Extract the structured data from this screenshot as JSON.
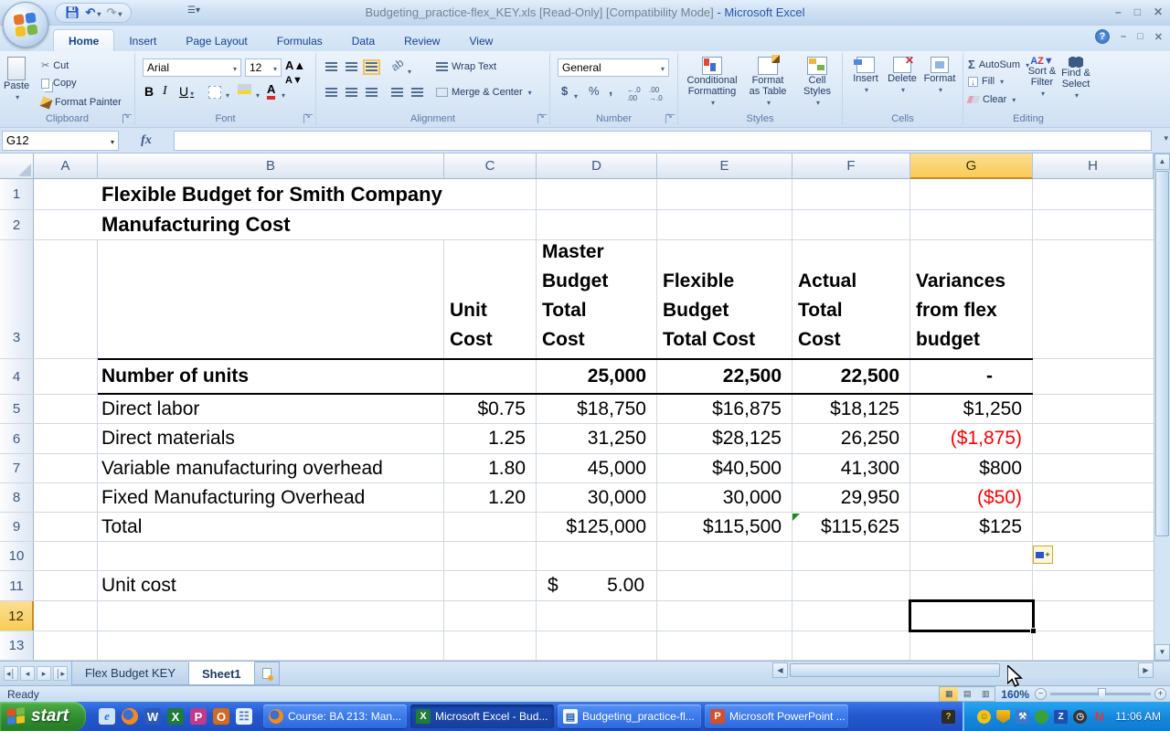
{
  "titlebar": {
    "filename": "Budgeting_practice-flex_KEY.xls  [Read-Only]  [Compatibility Mode]",
    "app": "- Microsoft Excel"
  },
  "ribbon": {
    "tabs": [
      {
        "label": "Home"
      },
      {
        "label": "Insert"
      },
      {
        "label": "Page Layout"
      },
      {
        "label": "Formulas"
      },
      {
        "label": "Data"
      },
      {
        "label": "Review"
      },
      {
        "label": "View"
      }
    ],
    "clipboard": {
      "label": "Clipboard",
      "paste": "Paste",
      "cut": "Cut",
      "copy": "Copy",
      "format_painter": "Format Painter"
    },
    "font": {
      "label": "Font",
      "family": "Arial",
      "size": "12"
    },
    "alignment": {
      "label": "Alignment",
      "wrap": "Wrap Text",
      "merge": "Merge & Center"
    },
    "number": {
      "label": "Number",
      "format": "General"
    },
    "styles": {
      "label": "Styles",
      "conditional": "Conditional\nFormatting",
      "as_table": "Format\nas Table",
      "cell_styles": "Cell\nStyles"
    },
    "cells": {
      "label": "Cells",
      "insert": "Insert",
      "delete": "Delete",
      "format": "Format"
    },
    "editing": {
      "label": "Editing",
      "autosum": "AutoSum",
      "fill": "Fill",
      "clear": "Clear",
      "sort": "Sort &\nFilter",
      "find": "Find &\nSelect"
    }
  },
  "formula_bar": {
    "name_box": "G12",
    "fx": "fx",
    "content": ""
  },
  "sheet": {
    "col_headers": [
      "A",
      "B",
      "C",
      "D",
      "E",
      "F",
      "G",
      "H"
    ],
    "row_headers": [
      "1",
      "2",
      "3",
      "4",
      "5",
      "6",
      "7",
      "8",
      "9",
      "10",
      "11",
      "12",
      "13"
    ],
    "selected_cell": "G12",
    "r1_title": "Flexible Budget for Smith Company",
    "r2_title": "Manufacturing Cost",
    "h": {
      "c": "Unit\nCost",
      "d": "Master\nBudget\nTotal\nCost",
      "e": "Flexible\nBudget\nTotal Cost",
      "f": "Actual\nTotal\nCost",
      "g": "Variances\nfrom flex\nbudget"
    },
    "r4": {
      "b": "Number of units",
      "d": "25,000",
      "e": "22,500",
      "f": "22,500",
      "g": "-"
    },
    "r5": {
      "b": "Direct labor",
      "c": "$0.75",
      "d": "$18,750",
      "e": "$16,875",
      "f": "$18,125",
      "g": "$1,250"
    },
    "r6": {
      "b": "Direct materials",
      "c": "1.25",
      "d": "31,250",
      "e": "$28,125",
      "f": "26,250",
      "g": "($1,875)"
    },
    "r7": {
      "b": "Variable manufacturing overhead",
      "c": "1.80",
      "d": "45,000",
      "e": "$40,500",
      "f": "41,300",
      "g": "$800"
    },
    "r8": {
      "b": "Fixed Manufacturing Overhead",
      "c": "1.20",
      "d": "30,000",
      "e": "30,000",
      "f": "29,950",
      "g": "($50)"
    },
    "r9": {
      "b": "Total",
      "d": "$125,000",
      "e": "$115,500",
      "f": "$115,625",
      "g": "$125"
    },
    "r11": {
      "b": "Unit cost",
      "d_currency": "$",
      "d_value": "5.00"
    }
  },
  "sheet_tabs": {
    "tabs": [
      {
        "label": "Flex Budget KEY"
      },
      {
        "label": "Sheet1"
      }
    ]
  },
  "status_bar": {
    "mode": "Ready",
    "zoom": "160%"
  },
  "taskbar": {
    "start": "start",
    "windows": [
      {
        "label": "Course: BA 213: Man..."
      },
      {
        "label": "Microsoft Excel - Bud..."
      },
      {
        "label": "Budgeting_practice-fl..."
      },
      {
        "label": "Microsoft PowerPoint ..."
      }
    ],
    "clock": "11:06 AM"
  },
  "colors": {
    "selection_gold": "#f9cb56",
    "negative_red": "#ff0000",
    "gridline": "#d0d7e5",
    "taskbar_blue": "#2458cf"
  }
}
